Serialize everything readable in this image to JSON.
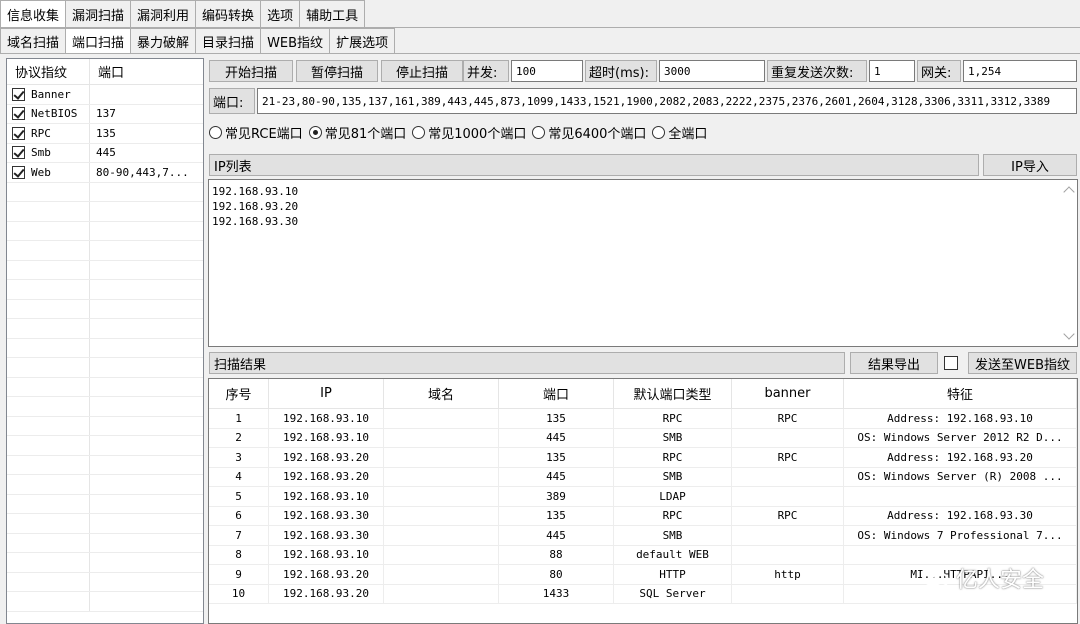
{
  "main_tabs": [
    "信息收集",
    "漏洞扫描",
    "漏洞利用",
    "编码转换",
    "选项",
    "辅助工具"
  ],
  "sub_tabs": [
    "域名扫描",
    "端口扫描",
    "暴力破解",
    "目录扫描",
    "WEB指纹",
    "扩展选项"
  ],
  "protocol_panel": {
    "headers": [
      "协议指纹",
      "端口"
    ],
    "rows": [
      {
        "name": "Banner",
        "port": "",
        "checked": true
      },
      {
        "name": "NetBIOS",
        "port": "137",
        "checked": true
      },
      {
        "name": "RPC",
        "port": "135",
        "checked": true
      },
      {
        "name": "Smb",
        "port": "445",
        "checked": true
      },
      {
        "name": "Web",
        "port": "80-90,443,7...",
        "checked": true
      }
    ]
  },
  "toolbar": {
    "start": "开始扫描",
    "pause": "暂停扫描",
    "stop": "停止扫描",
    "concurrency_label": "并发:",
    "concurrency_value": "100",
    "timeout_label": "超时(ms):",
    "timeout_value": "3000",
    "retry_label": "重复发送次数:",
    "retry_value": "1",
    "gateway_label": "网关:",
    "gateway_value": "1,254"
  },
  "ports": {
    "label": "端口:",
    "value": "21-23,80-90,135,137,161,389,443,445,873,1099,1433,1521,1900,2082,2083,2222,2375,2376,2601,2604,3128,3306,3311,3312,3389"
  },
  "port_presets": [
    {
      "label": "常见RCE端口",
      "selected": false
    },
    {
      "label": "常见81个端口",
      "selected": true
    },
    {
      "label": "常见1000个端口",
      "selected": false
    },
    {
      "label": "常见6400个端口",
      "selected": false
    },
    {
      "label": "全端口",
      "selected": false
    }
  ],
  "ip_list": {
    "title": "IP列表",
    "import_button": "IP导入",
    "ips": [
      "192.168.93.10",
      "192.168.93.20",
      "192.168.93.30"
    ]
  },
  "results": {
    "title": "扫描结果",
    "export_button": "结果导出",
    "send_button": "发送至WEB指纹",
    "headers": [
      "序号",
      "IP",
      "域名",
      "端口",
      "默认端口类型",
      "banner",
      "特征"
    ],
    "rows": [
      [
        "1",
        "192.168.93.10",
        "",
        "135",
        "RPC",
        "RPC",
        "Address: 192.168.93.10"
      ],
      [
        "2",
        "192.168.93.10",
        "",
        "445",
        "SMB",
        "",
        "OS: Windows Server 2012 R2 D..."
      ],
      [
        "3",
        "192.168.93.20",
        "",
        "135",
        "RPC",
        "RPC",
        "Address: 192.168.93.20"
      ],
      [
        "4",
        "192.168.93.20",
        "",
        "445",
        "SMB",
        "",
        "OS: Windows Server (R) 2008 ..."
      ],
      [
        "5",
        "192.168.93.10",
        "",
        "389",
        "LDAP",
        "",
        ""
      ],
      [
        "6",
        "192.168.93.30",
        "",
        "135",
        "RPC",
        "RPC",
        "Address: 192.168.93.30"
      ],
      [
        "7",
        "192.168.93.30",
        "",
        "445",
        "SMB",
        "",
        "OS: Windows 7 Professional 7..."
      ],
      [
        "8",
        "192.168.93.10",
        "",
        "88",
        "default WEB",
        "",
        ""
      ],
      [
        "9",
        "192.168.93.20",
        "",
        "80",
        "HTTP",
        "http",
        "MI...HTTPAPI..."
      ],
      [
        "10",
        "192.168.93.20",
        "",
        "1433",
        "SQL Server",
        "",
        ""
      ]
    ]
  },
  "watermark": "亿人安全"
}
